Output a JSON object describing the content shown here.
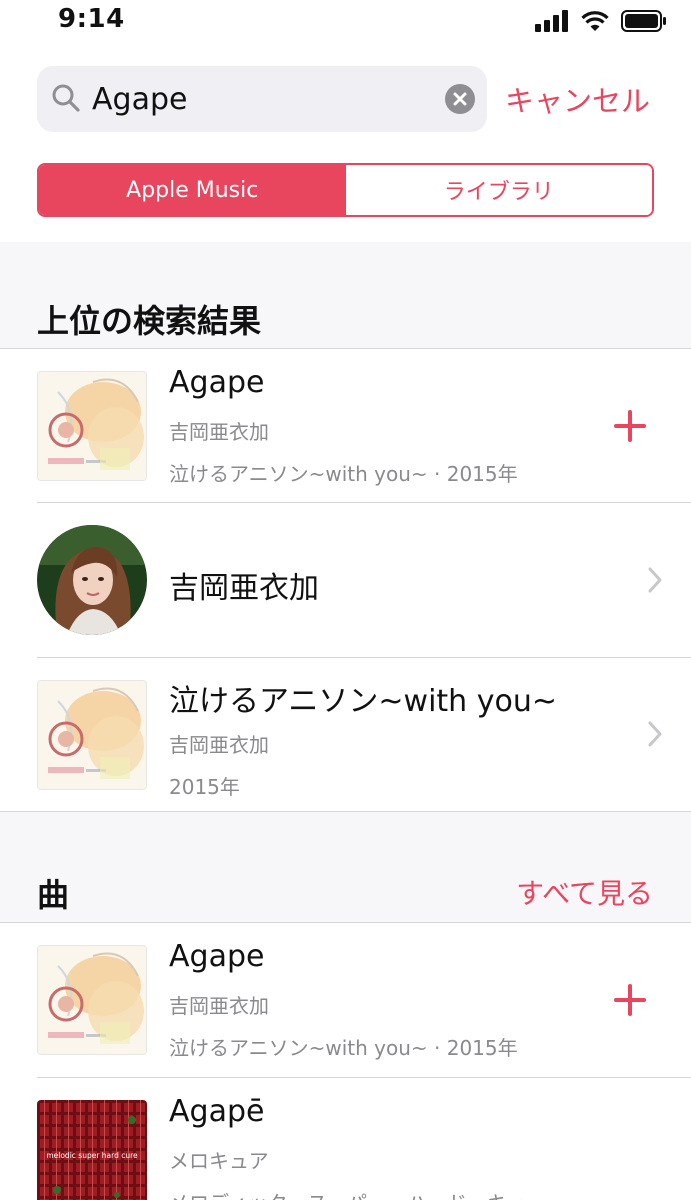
{
  "status": {
    "time": "9:14"
  },
  "search": {
    "value": "Agape",
    "cancel_label": "キャンセル"
  },
  "segments": {
    "apple_music": "Apple Music",
    "library": "ライブラリ"
  },
  "top_results": {
    "header": "上位の検索結果",
    "song": {
      "title": "Agape",
      "artist": "吉岡亜衣加",
      "meta": "泣けるアニソン~with you~ · 2015年"
    },
    "artist": {
      "name": "吉岡亜衣加"
    },
    "album": {
      "title": "泣けるアニソン~with you~",
      "artist": "吉岡亜衣加",
      "year": "2015年"
    }
  },
  "songs": {
    "header": "曲",
    "see_all": "すべて見る",
    "items": [
      {
        "title": "Agape",
        "artist": "吉岡亜衣加",
        "meta": "泣けるアニソン~with you~ · 2015年"
      },
      {
        "title": "Agapē",
        "artist": "メロキュア",
        "meta": "メロディック・スーパー・ハード・キュ…",
        "art_text": "melodic super hard cure"
      }
    ]
  },
  "colors": {
    "accent": "#e8455f"
  },
  "icons": [
    "search-icon",
    "clear-icon",
    "plus-icon",
    "chevron-right-icon",
    "signal-icon",
    "wifi-icon",
    "battery-icon"
  ]
}
